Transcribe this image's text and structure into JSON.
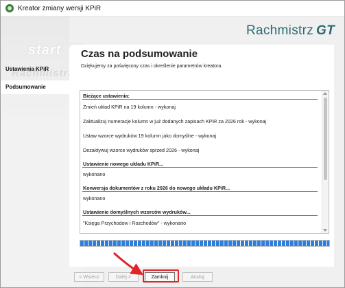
{
  "window": {
    "title": "Kreator zmiany wersji KPiR"
  },
  "watermark": {
    "line1": "start",
    "line2": "Rachmistrz"
  },
  "brand": {
    "name": "Rachmistrz",
    "suffix": "GT",
    "color": "#2c6a6e"
  },
  "sidebar": {
    "items": [
      {
        "label": "Ustawienia KPiR",
        "active": false
      },
      {
        "label": "Podsumowanie",
        "active": true
      }
    ]
  },
  "main": {
    "title": "Czas na podsumowanie",
    "subtitle": "Dziękujemy za poświęcony czas i określenie parametrów kreatora.",
    "summary": {
      "section1_header": "Bieżące ustawienia:",
      "section1_items": [
        "Zmień układ KPiR na 19 kolumn - wykonaj",
        "Zaktualizuj numeracje kolumn w już dodanych zapisach KPiR za 2026 rok - wykonaj",
        "Ustaw wzorce wydruków 19 kolumn jako domyślne - wykonaj",
        "Dezaktywuj wzorce wydruków sprzed 2026 - wykonaj"
      ],
      "section2_header": "Ustawienie nowego układu KPiR...",
      "section2_value": "wykonano",
      "section3_header": "Konwersja dokumentów z roku 2026 do nowego układu KPiR...",
      "section3_value": "wykonano",
      "section4_header": "Ustawienie domyślnych wzorców wydruków...",
      "section4_value": "\"Księga Przychodow i Rozchodów\" - wykonano"
    },
    "progress_fraction": 1.0
  },
  "buttons": {
    "back": "< Wstecz",
    "next": "Dalej >",
    "close": "Zamknij",
    "cancel": "Anuluj"
  },
  "colors": {
    "accent": "#2a7fe0",
    "highlight": "#e0242a"
  }
}
